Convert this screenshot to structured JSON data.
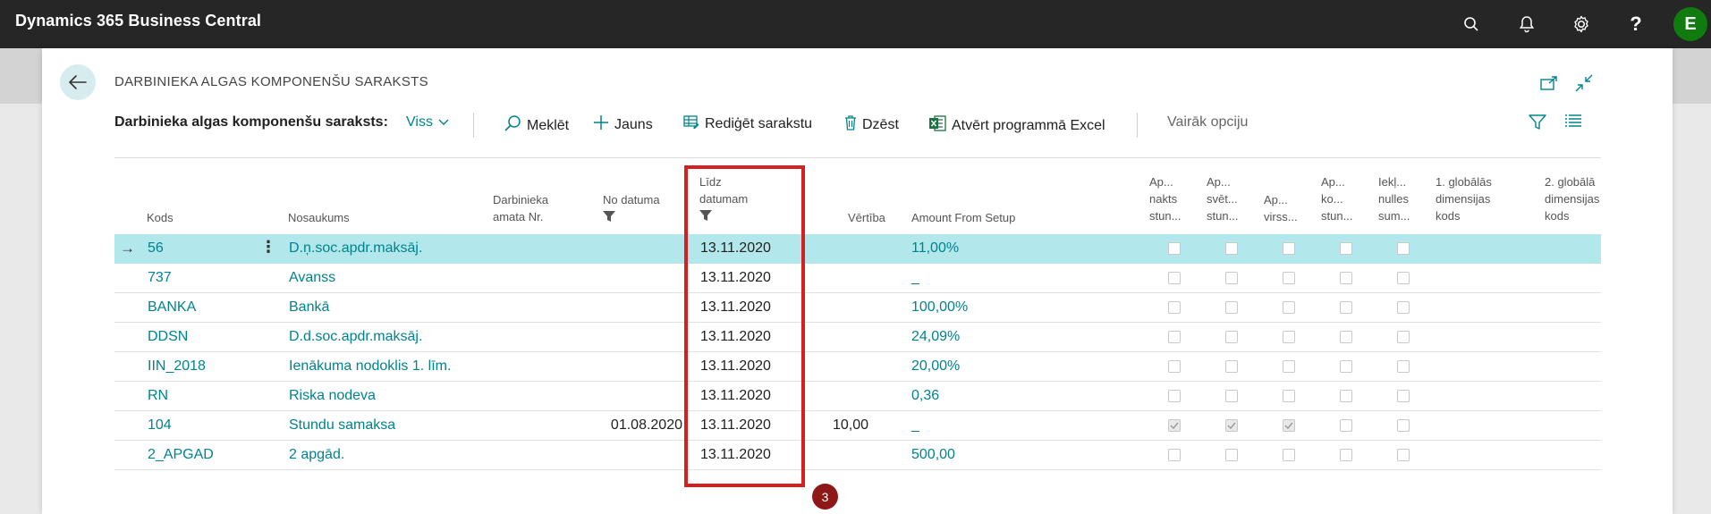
{
  "app": {
    "title": "Dynamics 365 Business Central",
    "user_initial": "E"
  },
  "topbar_icons": [
    "search-icon",
    "bell-icon",
    "gear-icon",
    "help-icon"
  ],
  "page": {
    "title": "DARBINIEKA ALGAS KOMPONENŠU SARAKSTS"
  },
  "actions": {
    "list_label": "Darbinieka algas komponenšu saraksts:",
    "view_filter": "Viss",
    "search": "Meklēt",
    "new": "Jauns",
    "edit_list": "Rediģēt sarakstu",
    "delete": "Dzēst",
    "open_excel": "Atvērt programmā Excel",
    "more": "Vairāk opciju"
  },
  "columns": {
    "code": "Kods",
    "name": "Nosaukums",
    "position_l1": "Darbinieka",
    "position_l2": "amata Nr.",
    "from_date": "No datuma",
    "to_date_l1": "Līdz",
    "to_date_l2": "datumam",
    "value": "Vērtība",
    "amount_from_setup": "Amount From Setup",
    "flag1": [
      "Ap...",
      "nakts",
      "stun..."
    ],
    "flag2": [
      "Ap...",
      "svēt...",
      "stun..."
    ],
    "flag3": [
      "Ap...",
      "virss..."
    ],
    "flag4": [
      "Ap...",
      "ko...",
      "stun..."
    ],
    "flag5": [
      "Iekļ...",
      "nulles",
      "sum..."
    ],
    "dim1": [
      "1. globālās",
      "dimensijas",
      "kods"
    ],
    "dim2": [
      "2. globālā",
      "dimensijas",
      "kods"
    ]
  },
  "rows": [
    {
      "code": "56",
      "name": "D.ņ.soc.apdr.maksāj.",
      "from_date": "",
      "to_date": "13.11.2020",
      "value": "",
      "amount": "11,00%",
      "flags": [
        false,
        false,
        false,
        false,
        false
      ]
    },
    {
      "code": "737",
      "name": "Avanss",
      "from_date": "",
      "to_date": "13.11.2020",
      "value": "",
      "amount": "_",
      "flags": [
        false,
        false,
        false,
        false,
        false
      ]
    },
    {
      "code": "BANKA",
      "name": "Bankā",
      "from_date": "",
      "to_date": "13.11.2020",
      "value": "",
      "amount": "100,00%",
      "flags": [
        false,
        false,
        false,
        false,
        false
      ]
    },
    {
      "code": "DDSN",
      "name": "D.d.soc.apdr.maksāj.",
      "from_date": "",
      "to_date": "13.11.2020",
      "value": "",
      "amount": "24,09%",
      "flags": [
        false,
        false,
        false,
        false,
        false
      ]
    },
    {
      "code": "IIN_2018",
      "name": "Ienākuma nodoklis 1. līm.",
      "from_date": "",
      "to_date": "13.11.2020",
      "value": "",
      "amount": "20,00%",
      "flags": [
        false,
        false,
        false,
        false,
        false
      ]
    },
    {
      "code": "RN",
      "name": "Riska nodeva",
      "from_date": "",
      "to_date": "13.11.2020",
      "value": "",
      "amount": "0,36",
      "flags": [
        false,
        false,
        false,
        false,
        false
      ]
    },
    {
      "code": "104",
      "name": "Stundu samaksa",
      "from_date": "01.08.2020",
      "to_date": "13.11.2020",
      "value": "10,00",
      "amount": "_",
      "flags": [
        true,
        true,
        true,
        false,
        false
      ]
    },
    {
      "code": "2_APGAD",
      "name": "2 apgād.",
      "from_date": "",
      "to_date": "13.11.2020",
      "value": "",
      "amount": "500,00",
      "flags": [
        false,
        false,
        false,
        false,
        false
      ]
    }
  ],
  "annotation": {
    "step": "3"
  },
  "colors": {
    "accent": "#00838f",
    "topbar": "#262626",
    "selected_row": "#b2e7eb",
    "highlight": "#d42020",
    "badge": "#8e1818",
    "avatar": "#107c10"
  }
}
